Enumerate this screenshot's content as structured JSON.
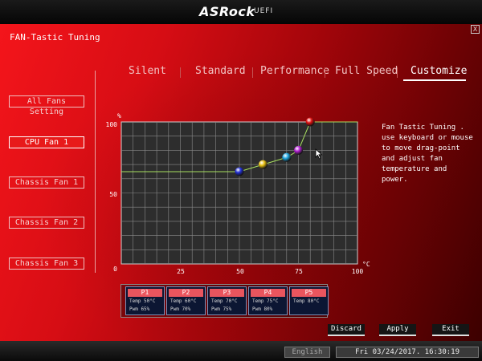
{
  "header": {
    "brand": "ASRock",
    "brand_sub": "UEFI",
    "close_icon": "close-icon",
    "close_glyph": "X"
  },
  "page_title": "FAN-Tastic Tuning",
  "tabs": [
    {
      "label": "Silent",
      "active": false
    },
    {
      "label": "Standard",
      "active": false
    },
    {
      "label": "Performance",
      "active": false
    },
    {
      "label": "Full Speed",
      "active": false
    },
    {
      "label": "Customize",
      "active": true
    }
  ],
  "sidebar": {
    "items": [
      {
        "label": "All Fans Setting",
        "active": false
      },
      {
        "label": "CPU Fan 1",
        "active": true
      },
      {
        "label": "Chassis Fan 1",
        "active": false
      },
      {
        "label": "Chassis Fan 2",
        "active": false
      },
      {
        "label": "Chassis Fan 3",
        "active": false
      }
    ]
  },
  "chart": {
    "y_unit": "%",
    "x_unit": "°C",
    "y_ticks": [
      "100",
      "50",
      "0"
    ],
    "x_ticks": [
      "25",
      "50",
      "75",
      "100"
    ]
  },
  "chart_data": {
    "type": "line",
    "x": [
      0,
      50,
      60,
      70,
      75,
      80,
      100
    ],
    "y": [
      65,
      65,
      70,
      75,
      80,
      100,
      100
    ],
    "xlim": [
      0,
      100
    ],
    "ylim": [
      0,
      100
    ],
    "grid": true,
    "points": [
      {
        "name": "P1",
        "temp": 50,
        "pwm": 65,
        "color": "#2230d6"
      },
      {
        "name": "P2",
        "temp": 60,
        "pwm": 70,
        "color": "#e8c010"
      },
      {
        "name": "P3",
        "temp": 70,
        "pwm": 75,
        "color": "#20a8e0"
      },
      {
        "name": "P4",
        "temp": 75,
        "pwm": 80,
        "color": "#b020d0"
      },
      {
        "name": "P5",
        "temp": 80,
        "pwm": 100,
        "color": "#e01010"
      }
    ],
    "line_color": "#a8e060"
  },
  "help_text": "Fan Tastic Tuning . use keyboard or mouse to move drag-point and adjust fan temperature and power.",
  "point_cards": [
    {
      "title": "P1",
      "temp": "Temp 50°C",
      "pwm": "Pwm  65%"
    },
    {
      "title": "P2",
      "temp": "Temp 60°C",
      "pwm": "Pwm  70%"
    },
    {
      "title": "P3",
      "temp": "Temp 70°C",
      "pwm": "Pwm  75%"
    },
    {
      "title": "P4",
      "temp": "Temp 75°C",
      "pwm": "Pwm  80%"
    },
    {
      "title": "P5",
      "temp": "Temp 80°C",
      "pwm": ""
    }
  ],
  "actions": {
    "discard": "Discard",
    "apply": "Apply",
    "exit": "Exit"
  },
  "footer": {
    "language": "English",
    "datetime": "Fri 03/24/2017. 16:30:19"
  },
  "colors": {
    "accent": "#e81a1a",
    "card_header": "#e9555e"
  }
}
